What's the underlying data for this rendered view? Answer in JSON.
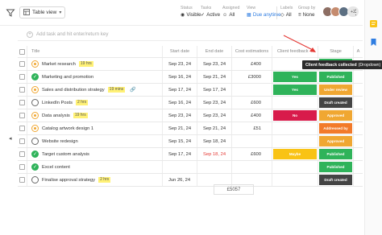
{
  "toolbar": {
    "view_label": "Table view",
    "status": {
      "label": "Status",
      "value": "Visible"
    },
    "tasks": {
      "label": "Tasks",
      "value": "Active"
    },
    "assigned": {
      "label": "Assigned",
      "value": "All"
    },
    "view": {
      "label": "View",
      "value": "Due anytime"
    },
    "labels": {
      "label": "Labels",
      "value": "All"
    },
    "groupby": {
      "label": "Group by",
      "value": "None"
    },
    "avatars_more": "+2"
  },
  "add_task": {
    "placeholder": "Add task and hit enter/return key"
  },
  "columns": {
    "title": "Title",
    "start": "Start date",
    "end": "End date",
    "cost": "Cost estimations",
    "feedback": "Client feedback",
    "stage": "Stage",
    "extra": "A"
  },
  "rows": [
    {
      "status": "progress",
      "title": "Market research",
      "hrs": "19 hrs",
      "start": "Sep 23, 24",
      "end": "Sep 23, 24",
      "end_overdue": false,
      "cost": "£400",
      "feedback": "",
      "stage": "Published"
    },
    {
      "status": "done",
      "title": "Marketing and promotion",
      "hrs": "",
      "start": "Sep 16, 24",
      "end": "Sep 21, 24",
      "end_overdue": false,
      "cost": "£3000",
      "feedback": "Yes",
      "stage": "Published"
    },
    {
      "status": "progress",
      "title": "Sales and distribution strategy",
      "hrs": "19 mins",
      "start": "Sep 17, 24",
      "end": "Sep 17, 24",
      "end_overdue": false,
      "cost": "",
      "feedback": "Yes",
      "stage": "Under review"
    },
    {
      "status": "todo",
      "title": "LinkedIn Posts",
      "hrs": "2 hrs",
      "start": "Sep 16, 24",
      "end": "Sep 23, 24",
      "end_overdue": false,
      "cost": "£600",
      "feedback": "",
      "stage": "Draft created"
    },
    {
      "status": "progress",
      "title": "Data analysis",
      "hrs": "19 hrs",
      "start": "Sep 23, 24",
      "end": "Sep 23, 24",
      "end_overdue": false,
      "cost": "£400",
      "feedback": "No",
      "stage": "Approved"
    },
    {
      "status": "progress",
      "title": "Catalog artwork design 1",
      "hrs": "",
      "start": "Sep 21, 24",
      "end": "Sep 21, 24",
      "end_overdue": false,
      "cost": "£51",
      "feedback": "",
      "stage": "Addressed by"
    },
    {
      "status": "todo",
      "title": "Website redesign",
      "hrs": "",
      "start": "Sep 15, 24",
      "end": "Sep 18, 24",
      "end_overdue": false,
      "cost": "",
      "feedback": "",
      "stage": "Approved"
    },
    {
      "status": "done",
      "title": "Target custom analysis",
      "hrs": "",
      "start": "Sep 17, 24",
      "end": "Sep 18, 24",
      "end_overdue": true,
      "cost": "£600",
      "feedback": "Maybe",
      "stage": "Published"
    },
    {
      "status": "done",
      "title": "Excel content",
      "hrs": "",
      "start": "",
      "end": "",
      "end_overdue": false,
      "cost": "",
      "feedback": "",
      "stage": "Published"
    },
    {
      "status": "todo",
      "title": "Finalise approval strategy",
      "hrs": "2 hrs",
      "start": "Jun 26, 24",
      "end": "",
      "end_overdue": false,
      "cost": "",
      "feedback": "",
      "stage": "Draft created"
    }
  ],
  "cost_total": "£5057",
  "tooltip": {
    "bold": "Client feedback collected",
    "rest": "(Dropdown)"
  },
  "colors": {
    "yes": "#2fb35a",
    "no": "#d81b4b",
    "maybe": "#f9c315",
    "published": "#2fb35a",
    "under_review": "#f0a732",
    "draft_created": "#444444",
    "approved": "#f0a732",
    "addressed_by": "#f27a2a",
    "accent": "#2f7de1",
    "arrow": "#e53935"
  }
}
